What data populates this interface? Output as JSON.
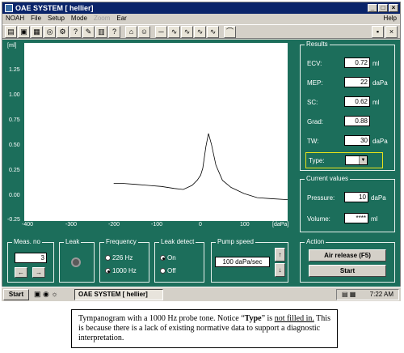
{
  "window": {
    "title": "OAE SYSTEM [ hellier]",
    "min": "_",
    "max": "□",
    "close": "×"
  },
  "menu": {
    "items": [
      "NOAH",
      "File",
      "Setup",
      "Mode",
      "Zoom",
      "Ear"
    ],
    "help": "Help"
  },
  "toolbar": {
    "icons": [
      "open-icon",
      "save-icon",
      "print-icon",
      "probe-icon",
      "settings-icon",
      "info-icon",
      "edit-icon",
      "chart-icon",
      "help-icon",
      "home-icon",
      "person-icon",
      "minus-icon",
      "wave-icon-1",
      "wave-icon-2",
      "wave-icon-3",
      "wave-icon-4",
      "curve-icon"
    ]
  },
  "plot": {
    "unit_label": "[ml]",
    "y_ticks": [
      "1.25",
      "1.00",
      "0.75",
      "0.50",
      "0.25",
      "0.00",
      "-0.25"
    ],
    "x_ticks": [
      "-400",
      "-300",
      "-200",
      "-100",
      "0",
      "100"
    ],
    "x_unit": "[daPa]"
  },
  "chart_data": {
    "type": "line",
    "ylabel": "[ml]",
    "xlabel": "[daPa]",
    "xlim": [
      -400,
      200
    ],
    "ylim": [
      -0.25,
      1.5
    ],
    "series": [
      {
        "x": [
          -200,
          -180,
          -150,
          -120,
          -90,
          -60,
          -40,
          -20,
          -8,
          0,
          5,
          12,
          18,
          25,
          35,
          50,
          70,
          100,
          130,
          160,
          200
        ],
        "values": [
          0.12,
          0.12,
          0.11,
          0.1,
          0.09,
          0.07,
          0.06,
          0.1,
          0.15,
          0.2,
          0.27,
          0.48,
          0.61,
          0.5,
          0.3,
          0.15,
          0.08,
          0.02,
          -0.02,
          -0.03,
          -0.04
        ]
      }
    ]
  },
  "results": {
    "title": "Results",
    "rows": [
      {
        "label": "ECV:",
        "value": "0.72",
        "unit": "ml"
      },
      {
        "label": "MEP:",
        "value": "22",
        "unit": "daPa"
      },
      {
        "label": "SC:",
        "value": "0.62",
        "unit": "ml"
      },
      {
        "label": "Grad:",
        "value": "0.88",
        "unit": ""
      },
      {
        "label": "TW:",
        "value": "30",
        "unit": "daPa"
      }
    ],
    "type_label": "Type:"
  },
  "current": {
    "title": "Current values",
    "pressure_label": "Pressure:",
    "pressure_value": "10",
    "pressure_unit": "daPa",
    "volume_label": "Volume:",
    "volume_value": "****",
    "volume_unit": "ml"
  },
  "meas": {
    "title": "Meas. no",
    "value": "3",
    "prev": "←",
    "next": "→"
  },
  "leak": {
    "title": "Leak"
  },
  "frequency": {
    "title": "Frequency",
    "opt1": "226 Hz",
    "opt2": "1000 Hz"
  },
  "leakdetect": {
    "title": "Leak detect",
    "opt1": "On",
    "opt2": "Off"
  },
  "pump": {
    "title": "Pump speed",
    "value": "100 daPa/sec",
    "up": "↑",
    "down": "↓"
  },
  "action": {
    "title": "Action",
    "release": "Air release (F5)",
    "start": "Start"
  },
  "taskbar": {
    "start": "Start",
    "task": "OAE SYSTEM [ hellier]",
    "time": "7:22 AM"
  },
  "caption": {
    "p1": "Tympanogram with a 1000 Hz probe tone. Notice “",
    "bold": "Type",
    "p2": "” is ",
    "underline": "not filled in.",
    "p3": " This is because there is a lack of existing normative data to support a diagnostic interpretation."
  },
  "colors": {
    "panel": "#1c6e5b",
    "plot_bg": "#ffffff",
    "highlight": "#e8e21a"
  }
}
